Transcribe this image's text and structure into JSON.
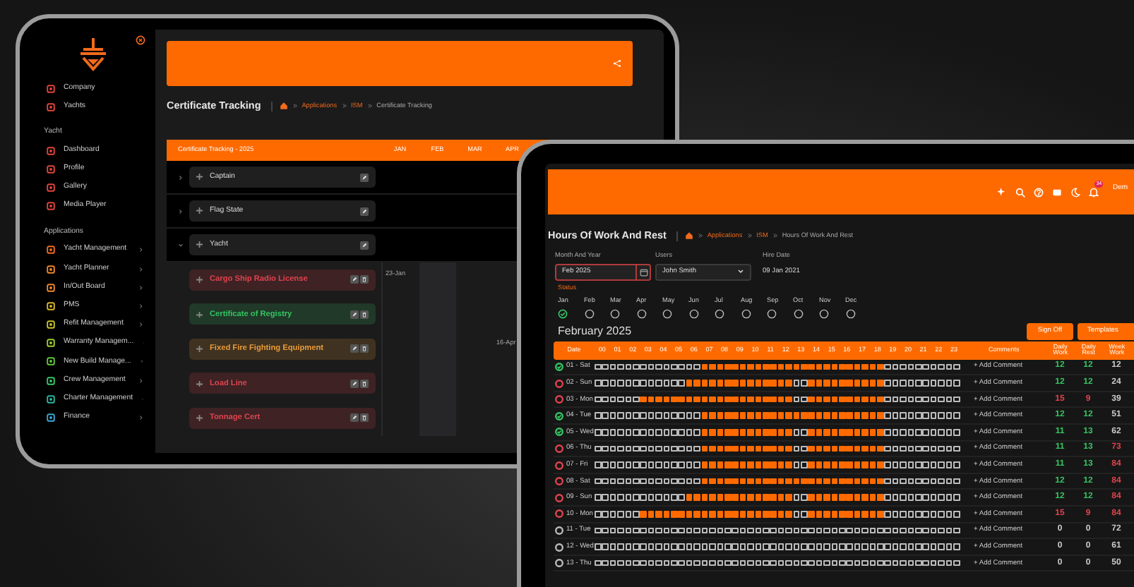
{
  "back_tablet": {
    "sidebar": {
      "top_items": [
        {
          "label": "Company",
          "color": "#e0443a"
        },
        {
          "label": "Yachts",
          "color": "#e0443a"
        }
      ],
      "sections": [
        {
          "title": "Yacht",
          "items": [
            {
              "label": "Dashboard",
              "color": "#e0443a",
              "expandable": false
            },
            {
              "label": "Profile",
              "color": "#e0443a",
              "expandable": false
            },
            {
              "label": "Gallery",
              "color": "#e0443a",
              "expandable": false
            },
            {
              "label": "Media Player",
              "color": "#e0443a",
              "expandable": false
            }
          ]
        },
        {
          "title": "Applications",
          "items": [
            {
              "label": "Yacht Management",
              "color": "#f26a1b",
              "expandable": true
            },
            {
              "label": "Yacht Planner",
              "color": "#f0862a",
              "expandable": true
            },
            {
              "label": "In/Out Board",
              "color": "#f0862a",
              "expandable": true
            },
            {
              "label": "PMS",
              "color": "#d9b526",
              "expandable": true
            },
            {
              "label": "Refit Management",
              "color": "#c9c42a",
              "expandable": true
            },
            {
              "label": "Warranty Managem...",
              "color": "#9ccc2e",
              "expandable": true
            },
            {
              "label": "New Build Manage...",
              "color": "#5fc83a",
              "expandable": true
            },
            {
              "label": "Crew Management",
              "color": "#3ac46a",
              "expandable": true
            },
            {
              "label": "Charter Management",
              "color": "#2bb6a0",
              "expandable": true
            },
            {
              "label": "Finance",
              "color": "#38a8d8",
              "expandable": true
            }
          ]
        }
      ]
    },
    "page_title": "Certificate Tracking",
    "breadcrumb": [
      "Applications",
      "ISM",
      "Certificate Tracking"
    ],
    "tracker": {
      "title": "Certificate Tracking - 2025",
      "months": [
        "JAN",
        "FEB",
        "MAR",
        "APR"
      ],
      "groups": [
        {
          "label": "Captain",
          "expanded": false
        },
        {
          "label": "Flag State",
          "expanded": false
        },
        {
          "label": "Yacht",
          "expanded": true,
          "children": [
            {
              "label": "Cargo Ship Radio License",
              "color": "#e0444e",
              "cells": [
                "23-Jan",
                null,
                null,
                null
              ]
            },
            {
              "label": "Certificate of Registry",
              "color": "#35c463",
              "cells": [
                null,
                null,
                null,
                null
              ]
            },
            {
              "label": "Fixed Fire Fighting Equipment",
              "color": "#e89a3a",
              "cells": [
                null,
                null,
                null,
                "16-Apr"
              ]
            },
            {
              "label": "Load Line",
              "color": "#e0444e",
              "cells": [
                null,
                null,
                null,
                null
              ]
            },
            {
              "label": "Tonnage Cert",
              "color": "#e0444e",
              "cells": [
                null,
                null,
                null,
                null
              ]
            }
          ]
        }
      ]
    }
  },
  "front_tablet": {
    "topbar": {
      "badge": "34",
      "user": "Dem"
    },
    "page_title": "Hours Of Work And Rest",
    "breadcrumb": [
      "Applications",
      "ISM",
      "Hours Of Work And Rest"
    ],
    "filters": [
      {
        "label": "Month And Year",
        "value": "Feb 2025",
        "kind": "date",
        "invalid": true
      },
      {
        "label": "Users",
        "value": "John Smith",
        "kind": "select",
        "invalid": false
      },
      {
        "label": "Hire Date",
        "value": "09 Jan 2021",
        "kind": "text",
        "invalid": false
      }
    ],
    "status_label": "Status",
    "months": [
      {
        "label": "Jan",
        "signed": true
      },
      {
        "label": "Feb",
        "signed": false
      },
      {
        "label": "Mar",
        "signed": false
      },
      {
        "label": "Apr",
        "signed": false
      },
      {
        "label": "May",
        "signed": false
      },
      {
        "label": "Jun",
        "signed": false
      },
      {
        "label": "Jul",
        "signed": false
      },
      {
        "label": "Aug",
        "signed": false
      },
      {
        "label": "Sep",
        "signed": false
      },
      {
        "label": "Oct",
        "signed": false
      },
      {
        "label": "Nov",
        "signed": false
      },
      {
        "label": "Dec",
        "signed": false
      }
    ],
    "month_title": "February 2025",
    "buttons": [
      "Sign Off",
      "Templates"
    ],
    "table": {
      "columns": {
        "date": "Date",
        "hours": [
          "00",
          "01",
          "02",
          "03",
          "04",
          "05",
          "06",
          "07",
          "08",
          "09",
          "10",
          "11",
          "12",
          "13",
          "14",
          "15",
          "16",
          "17",
          "18",
          "19",
          "20",
          "21",
          "22",
          "23"
        ],
        "comments": "Comments",
        "daily_work": "Daily Work",
        "daily_rest": "Daily Rest",
        "weekly": "Week Work"
      },
      "rows": [
        {
          "date": "01 - Sat",
          "status": {
            "checked": true,
            "color": "#35c463"
          },
          "comment": "+ Add Comment",
          "daily_work": {
            "value": "12",
            "color": "#35c463"
          },
          "daily_rest": {
            "value": "12",
            "color": "#35c463"
          },
          "weekly": {
            "value": "12",
            "color": "#cccccc"
          },
          "slots": [
            false,
            false,
            false,
            false,
            false,
            false,
            false,
            false,
            false,
            false,
            false,
            false,
            false,
            false,
            true,
            true,
            true,
            true,
            true,
            true,
            true,
            true,
            true,
            true,
            true,
            true,
            true,
            true,
            true,
            true,
            true,
            true,
            true,
            true,
            true,
            true,
            true,
            true,
            false,
            false,
            false,
            false,
            false,
            false,
            false,
            false,
            false,
            false
          ]
        },
        {
          "date": "02 - Sun",
          "status": {
            "checked": false,
            "color": "#e0444e"
          },
          "comment": "+ Add Comment",
          "daily_work": {
            "value": "12",
            "color": "#35c463"
          },
          "daily_rest": {
            "value": "12",
            "color": "#35c463"
          },
          "weekly": {
            "value": "24",
            "color": "#cccccc"
          },
          "slots": [
            false,
            false,
            false,
            false,
            false,
            false,
            false,
            false,
            false,
            false,
            false,
            false,
            true,
            true,
            true,
            true,
            true,
            true,
            true,
            true,
            true,
            true,
            true,
            true,
            true,
            true,
            false,
            false,
            true,
            true,
            true,
            true,
            true,
            true,
            true,
            true,
            true,
            true,
            false,
            false,
            false,
            false,
            false,
            false,
            false,
            false,
            false,
            false
          ]
        },
        {
          "date": "03 - Mon",
          "status": {
            "checked": false,
            "color": "#e0444e"
          },
          "comment": "+ Add Comment",
          "daily_work": {
            "value": "15",
            "color": "#e0444e"
          },
          "daily_rest": {
            "value": "9",
            "color": "#e0444e"
          },
          "weekly": {
            "value": "39",
            "color": "#cccccc"
          },
          "slots": [
            false,
            false,
            false,
            false,
            false,
            false,
            true,
            true,
            true,
            true,
            true,
            true,
            true,
            true,
            true,
            true,
            true,
            true,
            true,
            true,
            true,
            true,
            true,
            true,
            true,
            true,
            false,
            false,
            true,
            true,
            true,
            true,
            true,
            true,
            true,
            true,
            true,
            true,
            false,
            false,
            false,
            false,
            false,
            false,
            false,
            false,
            false,
            false
          ]
        },
        {
          "date": "04 - Tue",
          "status": {
            "checked": true,
            "color": "#35c463"
          },
          "comment": "+ Add Comment",
          "daily_work": {
            "value": "12",
            "color": "#35c463"
          },
          "daily_rest": {
            "value": "12",
            "color": "#35c463"
          },
          "weekly": {
            "value": "51",
            "color": "#cccccc"
          },
          "slots": [
            false,
            false,
            false,
            false,
            false,
            false,
            false,
            false,
            false,
            false,
            false,
            false,
            false,
            false,
            true,
            true,
            true,
            true,
            true,
            true,
            true,
            true,
            true,
            true,
            true,
            true,
            true,
            true,
            true,
            true,
            true,
            true,
            true,
            true,
            true,
            true,
            true,
            true,
            false,
            false,
            false,
            false,
            false,
            false,
            false,
            false,
            false,
            false
          ]
        },
        {
          "date": "05 - Wed",
          "status": {
            "checked": true,
            "color": "#35c463"
          },
          "comment": "+ Add Comment",
          "daily_work": {
            "value": "11",
            "color": "#35c463"
          },
          "daily_rest": {
            "value": "13",
            "color": "#35c463"
          },
          "weekly": {
            "value": "62",
            "color": "#cccccc"
          },
          "slots": [
            false,
            false,
            false,
            false,
            false,
            false,
            false,
            false,
            false,
            false,
            false,
            false,
            false,
            false,
            true,
            true,
            true,
            true,
            true,
            true,
            true,
            true,
            true,
            true,
            true,
            true,
            false,
            false,
            true,
            true,
            true,
            true,
            true,
            true,
            true,
            true,
            true,
            true,
            false,
            false,
            false,
            false,
            false,
            false,
            false,
            false,
            false,
            false
          ]
        },
        {
          "date": "06 - Thu",
          "status": {
            "checked": false,
            "color": "#e0444e"
          },
          "comment": "+ Add Comment",
          "daily_work": {
            "value": "11",
            "color": "#35c463"
          },
          "daily_rest": {
            "value": "13",
            "color": "#35c463"
          },
          "weekly": {
            "value": "73",
            "color": "#e0444e"
          },
          "slots": [
            false,
            false,
            false,
            false,
            false,
            false,
            false,
            false,
            false,
            false,
            false,
            false,
            false,
            false,
            true,
            true,
            true,
            true,
            true,
            true,
            true,
            true,
            true,
            true,
            true,
            true,
            false,
            false,
            true,
            true,
            true,
            true,
            true,
            true,
            true,
            true,
            true,
            true,
            false,
            false,
            false,
            false,
            false,
            false,
            false,
            false,
            false,
            false
          ]
        },
        {
          "date": "07 - Fri",
          "status": {
            "checked": false,
            "color": "#e0444e"
          },
          "comment": "+ Add Comment",
          "daily_work": {
            "value": "11",
            "color": "#35c463"
          },
          "daily_rest": {
            "value": "13",
            "color": "#35c463"
          },
          "weekly": {
            "value": "84",
            "color": "#e0444e"
          },
          "slots": [
            false,
            false,
            false,
            false,
            false,
            false,
            false,
            false,
            false,
            false,
            false,
            false,
            false,
            false,
            true,
            true,
            true,
            true,
            true,
            true,
            true,
            true,
            true,
            true,
            true,
            true,
            false,
            false,
            true,
            true,
            true,
            true,
            true,
            true,
            true,
            true,
            true,
            true,
            false,
            false,
            false,
            false,
            false,
            false,
            false,
            false,
            false,
            false
          ]
        },
        {
          "date": "08 - Sat",
          "status": {
            "checked": false,
            "color": "#e0444e"
          },
          "comment": "+ Add Comment",
          "daily_work": {
            "value": "12",
            "color": "#35c463"
          },
          "daily_rest": {
            "value": "12",
            "color": "#35c463"
          },
          "weekly": {
            "value": "84",
            "color": "#e0444e"
          },
          "slots": [
            false,
            false,
            false,
            false,
            false,
            false,
            false,
            false,
            false,
            false,
            false,
            false,
            false,
            false,
            true,
            true,
            true,
            true,
            true,
            true,
            true,
            true,
            true,
            true,
            true,
            true,
            true,
            true,
            true,
            true,
            true,
            true,
            true,
            true,
            true,
            true,
            true,
            true,
            false,
            false,
            false,
            false,
            false,
            false,
            false,
            false,
            false,
            false
          ]
        },
        {
          "date": "09 - Sun",
          "status": {
            "checked": false,
            "color": "#e0444e"
          },
          "comment": "+ Add Comment",
          "daily_work": {
            "value": "12",
            "color": "#35c463"
          },
          "daily_rest": {
            "value": "12",
            "color": "#35c463"
          },
          "weekly": {
            "value": "84",
            "color": "#e0444e"
          },
          "slots": [
            false,
            false,
            false,
            false,
            false,
            false,
            false,
            false,
            false,
            false,
            false,
            false,
            true,
            true,
            true,
            true,
            true,
            true,
            true,
            true,
            true,
            true,
            true,
            true,
            true,
            true,
            false,
            false,
            true,
            true,
            true,
            true,
            true,
            true,
            true,
            true,
            true,
            true,
            false,
            false,
            false,
            false,
            false,
            false,
            false,
            false,
            false,
            false
          ]
        },
        {
          "date": "10 - Mon",
          "status": {
            "checked": false,
            "color": "#e0444e"
          },
          "comment": "+ Add Comment",
          "daily_work": {
            "value": "15",
            "color": "#e0444e"
          },
          "daily_rest": {
            "value": "9",
            "color": "#e0444e"
          },
          "weekly": {
            "value": "84",
            "color": "#e0444e"
          },
          "slots": [
            false,
            false,
            false,
            false,
            false,
            false,
            true,
            true,
            true,
            true,
            true,
            true,
            true,
            true,
            true,
            true,
            true,
            true,
            true,
            true,
            true,
            true,
            true,
            true,
            true,
            true,
            false,
            false,
            true,
            true,
            true,
            true,
            true,
            true,
            true,
            true,
            true,
            true,
            false,
            false,
            false,
            false,
            false,
            false,
            false,
            false,
            false,
            false
          ]
        },
        {
          "date": "11 - Tue",
          "status": {
            "checked": false,
            "color": "#bbbbbb"
          },
          "comment": "+ Add Comment",
          "daily_work": {
            "value": "0",
            "color": "#cccccc"
          },
          "daily_rest": {
            "value": "0",
            "color": "#cccccc"
          },
          "weekly": {
            "value": "72",
            "color": "#cccccc"
          },
          "slots": [
            false,
            false,
            false,
            false,
            false,
            false,
            false,
            false,
            false,
            false,
            false,
            false,
            false,
            false,
            false,
            false,
            false,
            false,
            false,
            false,
            false,
            false,
            false,
            false,
            false,
            false,
            false,
            false,
            false,
            false,
            false,
            false,
            false,
            false,
            false,
            false,
            false,
            false,
            false,
            false,
            false,
            false,
            false,
            false,
            false,
            false,
            false,
            false
          ]
        },
        {
          "date": "12 - Wed",
          "status": {
            "checked": false,
            "color": "#bbbbbb"
          },
          "comment": "+ Add Comment",
          "daily_work": {
            "value": "0",
            "color": "#cccccc"
          },
          "daily_rest": {
            "value": "0",
            "color": "#cccccc"
          },
          "weekly": {
            "value": "61",
            "color": "#cccccc"
          },
          "slots": [
            false,
            false,
            false,
            false,
            false,
            false,
            false,
            false,
            false,
            false,
            false,
            false,
            false,
            false,
            false,
            false,
            false,
            false,
            false,
            false,
            false,
            false,
            false,
            false,
            false,
            false,
            false,
            false,
            false,
            false,
            false,
            false,
            false,
            false,
            false,
            false,
            false,
            false,
            false,
            false,
            false,
            false,
            false,
            false,
            false,
            false,
            false,
            false
          ]
        },
        {
          "date": "13 - Thu",
          "status": {
            "checked": false,
            "color": "#bbbbbb"
          },
          "comment": "+ Add Comment",
          "daily_work": {
            "value": "0",
            "color": "#cccccc"
          },
          "daily_rest": {
            "value": "0",
            "color": "#cccccc"
          },
          "weekly": {
            "value": "50",
            "color": "#cccccc"
          },
          "slots": [
            false,
            false,
            false,
            false,
            false,
            false,
            false,
            false,
            false,
            false,
            false,
            false,
            false,
            false,
            false,
            false,
            false,
            false,
            false,
            false,
            false,
            false,
            false,
            false,
            false,
            false,
            false,
            false,
            false,
            false,
            false,
            false,
            false,
            false,
            false,
            false,
            false,
            false,
            false,
            false,
            false,
            false,
            false,
            false,
            false,
            false,
            false,
            false
          ]
        }
      ]
    }
  }
}
